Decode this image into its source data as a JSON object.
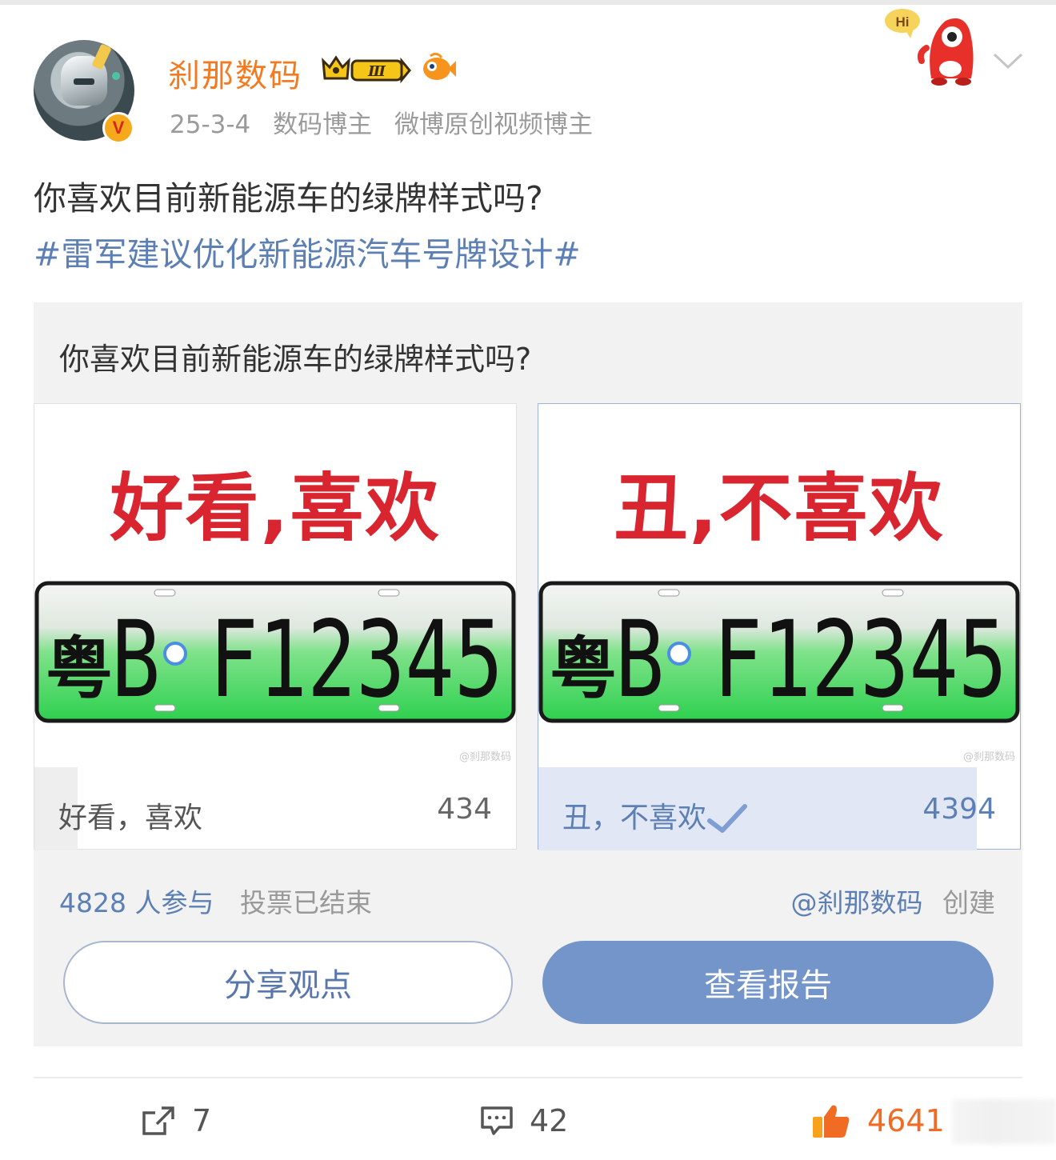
{
  "header": {
    "username": "刹那数码",
    "badge_level": "Ⅲ",
    "verified_mark": "V",
    "date": "25-3-4",
    "tag1": "数码博主",
    "tag2": "微博原创视频博主",
    "mascot_greeting": "Hi"
  },
  "post": {
    "text": "你喜欢目前新能源车的绿牌样式吗?",
    "topic": "#雷军建议优化新能源汽车号牌设计#"
  },
  "poll": {
    "question": "你喜欢目前新能源车的绿牌样式吗?",
    "options": [
      {
        "image_caption": "好看,喜欢",
        "label": "好看，喜欢",
        "count": "434",
        "share": 0.09,
        "selected": false,
        "plate_province": "粤",
        "plate_number": "B F12345",
        "watermark": "@刹那数码"
      },
      {
        "image_caption": "丑,不喜欢",
        "label": "丑，不喜欢",
        "count": "4394",
        "share": 0.91,
        "selected": true,
        "plate_province": "粤",
        "plate_number": "B F12345",
        "watermark": "@刹那数码"
      }
    ],
    "participants": "4828 人参与",
    "status": "投票已结束",
    "creator": "@刹那数码",
    "creator_suffix": "创建",
    "share_button": "分享观点",
    "report_button": "查看报告"
  },
  "actions": {
    "repost_count": "7",
    "comment_count": "42",
    "like_count": "4641"
  },
  "colors": {
    "username": "#f27b21",
    "link": "#5c7fb4",
    "accent_button": "#7495c9",
    "like": "#f06b24",
    "caption_red": "#d9252f",
    "plate_green": "#2fd65a"
  },
  "icons": [
    "crown-level-icon",
    "fish-badge-icon",
    "mascot-icon",
    "chevron-down-icon",
    "check-icon",
    "repost-icon",
    "comment-icon",
    "like-icon"
  ]
}
